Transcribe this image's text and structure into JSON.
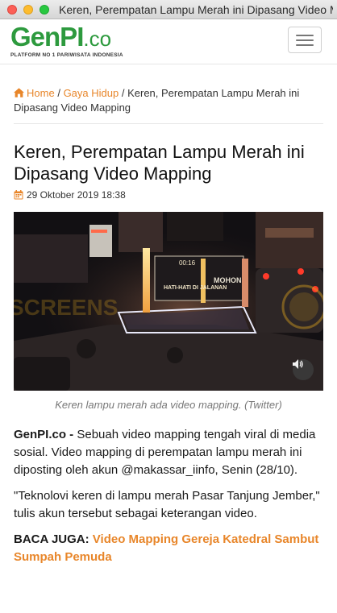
{
  "window": {
    "title": "Keren, Perempatan Lampu Merah ini Dipasang Video M..."
  },
  "site": {
    "logo_main": "GenPI",
    "logo_suffix": ".co",
    "logo_tagline": "PLATFORM NO 1 PARIWISATA INDONESIA"
  },
  "breadcrumb": {
    "home": "Home",
    "separator": "/",
    "category": "Gaya Hidup",
    "current": "Keren, Perempatan Lampu Merah ini Dipasang Video Mapping"
  },
  "article": {
    "title": "Keren, Perempatan Lampu Merah ini Dipasang Video Mapping",
    "date": "29 Oktober 2019 18:38",
    "photo_overlay_texts": [
      "HATI-HATI DI JALANAN",
      "MOHON",
      "00:16"
    ],
    "caption": "Keren lampu merah ada video mapping. (Twitter)",
    "p1_lead": "GenPI.co -",
    "p1_body": " Sebuah video mapping  tengah viral di media sosial. Video mapping di perempatan lampu merah ini diposting oleh akun @makassar_iinfo,  Senin (28/10).",
    "p2": "\"Teknolovi keren di lampu merah Pasar Tanjung Jember,\" tulis akun tersebut sebagai keterangan video.",
    "related_label": "BACA JUGA:",
    "related_link": "Video Mapping Gereja Katedral Sambut Sumpah Pemuda"
  },
  "colors": {
    "accent": "#e8862a",
    "brand_green": "#2d9a3e"
  },
  "icons": [
    "home-icon",
    "calendar-icon",
    "speaker-icon",
    "hamburger-icon"
  ]
}
